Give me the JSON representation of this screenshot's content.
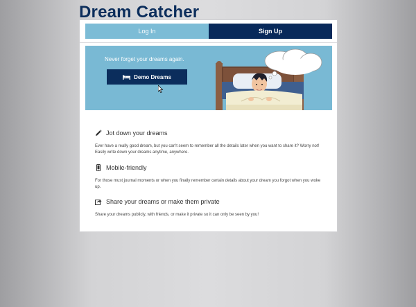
{
  "app": {
    "title": "Dream Catcher"
  },
  "auth_tabs": {
    "login_label": "Log In",
    "signup_label": "Sign Up"
  },
  "hero": {
    "tagline": "Never forget your dreams again.",
    "demo_button_label": "Demo Dreams",
    "demo_button_icon": "bed-icon"
  },
  "features": [
    {
      "icon": "pencil-icon",
      "title": "Jot down your dreams",
      "description": "Ever have a really good dream, but you can't seem to remember all the details later when you want to share it? Worry not! Easily write down your dreams anytime, anywhere."
    },
    {
      "icon": "mobile-icon",
      "title": "Mobile-friendly",
      "description": "For those must journal moments or when you finally remember certain details about your dream you forgot when you woke up."
    },
    {
      "icon": "share-icon",
      "title": "Share your dreams or make them private",
      "description": "Share your dreams publicly, with friends, or make it private so it can only be seen by you!"
    }
  ],
  "colors": {
    "navy": "#0b2d5c",
    "light_blue": "#7cbcd6",
    "title_color": "#0c2e5c"
  }
}
